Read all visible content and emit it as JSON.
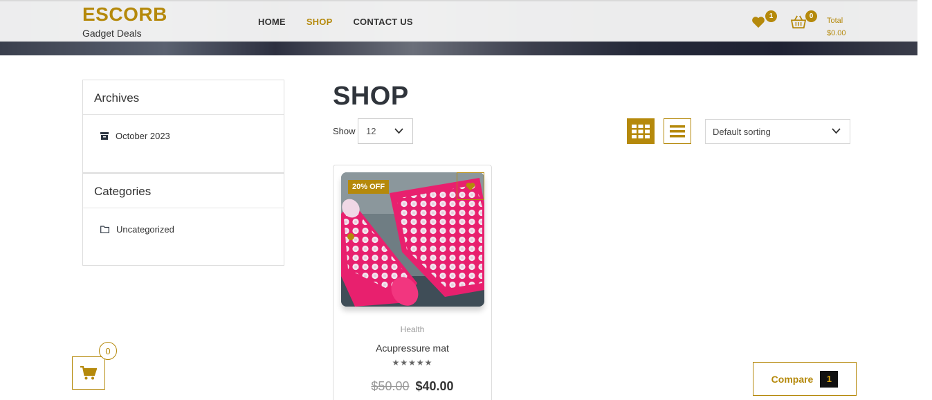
{
  "brand": {
    "name": "ESCORB",
    "tagline": "Gadget Deals"
  },
  "nav": {
    "home": "HOME",
    "shop": "SHOP",
    "contact": "CONTACT US"
  },
  "header": {
    "wishlist_count": "1",
    "cart_count": "0",
    "total_label": "Total",
    "total_value": "$0.00"
  },
  "sidebar": {
    "archives": {
      "title": "Archives",
      "items": [
        {
          "label": "October 2023"
        }
      ]
    },
    "categories": {
      "title": "Categories",
      "items": [
        {
          "label": "Uncategorized"
        }
      ]
    }
  },
  "shop": {
    "title": "SHOP",
    "show_label": "Show",
    "show_value": "12",
    "sort_value": "Default sorting"
  },
  "products": [
    {
      "badge": "20% OFF",
      "category": "Health",
      "name": "Acupressure mat",
      "rating_stars": "★★★★★",
      "old_price": "$50.00",
      "price": "$40.00"
    }
  ],
  "floating_cart": {
    "count": "0"
  },
  "compare": {
    "label": "Compare",
    "count": "1"
  },
  "colors": {
    "accent": "#b5890b",
    "text": "#333333",
    "border": "#dddddd"
  }
}
